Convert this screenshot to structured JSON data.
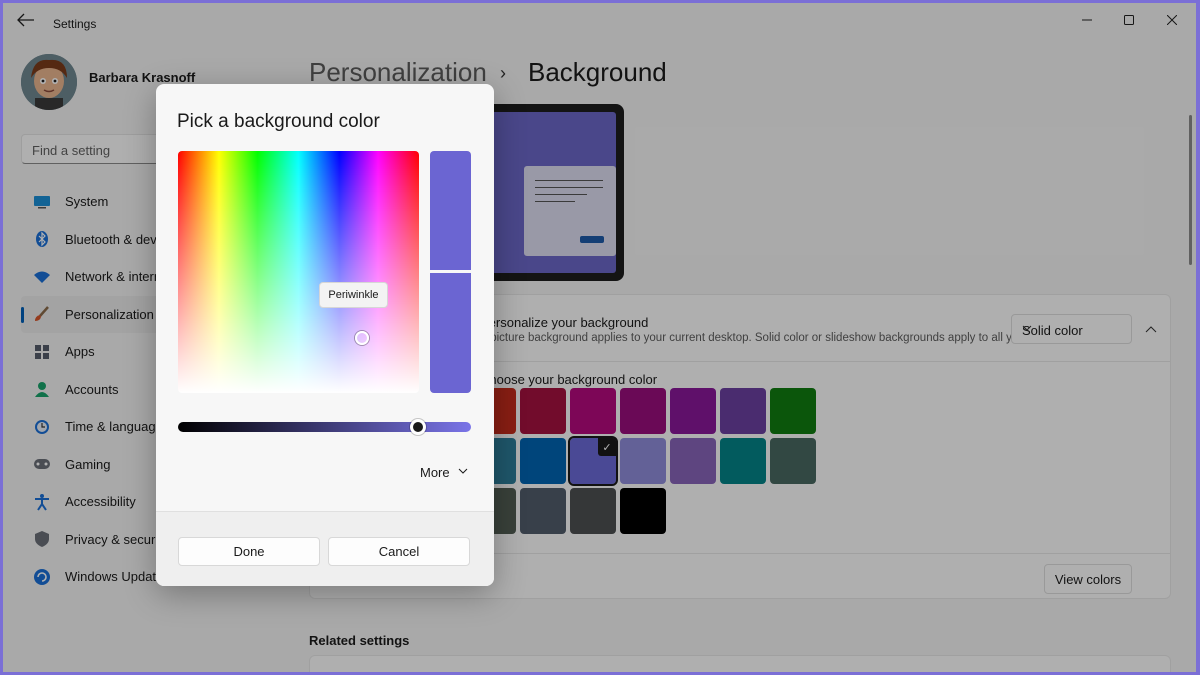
{
  "app": {
    "title": "Settings",
    "back_icon": "back-arrow-icon",
    "controls": {
      "minimize": "minimize-icon",
      "maximize": "maximize-icon",
      "close": "close-icon"
    }
  },
  "profile": {
    "name": "Barbara Krasnoff"
  },
  "search": {
    "placeholder": "Find a setting"
  },
  "sidebar": {
    "items": [
      {
        "label": "System",
        "icon": "monitor-icon"
      },
      {
        "label": "Bluetooth & devices",
        "icon": "bluetooth-icon"
      },
      {
        "label": "Network & internet",
        "icon": "wifi-icon"
      },
      {
        "label": "Personalization",
        "icon": "brush-icon",
        "active": true
      },
      {
        "label": "Apps",
        "icon": "apps-icon"
      },
      {
        "label": "Accounts",
        "icon": "person-icon"
      },
      {
        "label": "Time & language",
        "icon": "clock-globe-icon"
      },
      {
        "label": "Gaming",
        "icon": "gamepad-icon"
      },
      {
        "label": "Accessibility",
        "icon": "accessibility-icon"
      },
      {
        "label": "Privacy & security",
        "icon": "shield-icon"
      },
      {
        "label": "Windows Update",
        "icon": "update-icon"
      }
    ]
  },
  "header": {
    "parent": "Personalization",
    "separator": "›",
    "current": "Background"
  },
  "background_card": {
    "title": "Personalize your background",
    "description": "A picture background applies to your current desktop. Solid color or slideshow backgrounds apply to all your desktops.",
    "select_value": "Solid color",
    "colors_label": "Choose your background color",
    "view_colors_label": "View colors",
    "swatches": [
      [
        "#c42b1c",
        "#a4123f",
        "#b4097d",
        "#980d7b",
        "#881798",
        "#6b3fa0",
        "#107c10"
      ],
      [
        "#2d7d9a",
        "#0063b1",
        "#6b69d6",
        "#8e8cd8",
        "#8764b8",
        "#038387",
        "#486860"
      ],
      [
        "#525e54",
        "#515c6b",
        "#4c5051",
        "#000000"
      ]
    ],
    "selected_swatch": "#6b69d6"
  },
  "related": {
    "title": "Related settings"
  },
  "dialog": {
    "title": "Pick a background color",
    "tooltip": "Periwinkle",
    "selected_color": "#6b65d2",
    "value_level": 0.82,
    "more_label": "More",
    "done_label": "Done",
    "cancel_label": "Cancel"
  }
}
